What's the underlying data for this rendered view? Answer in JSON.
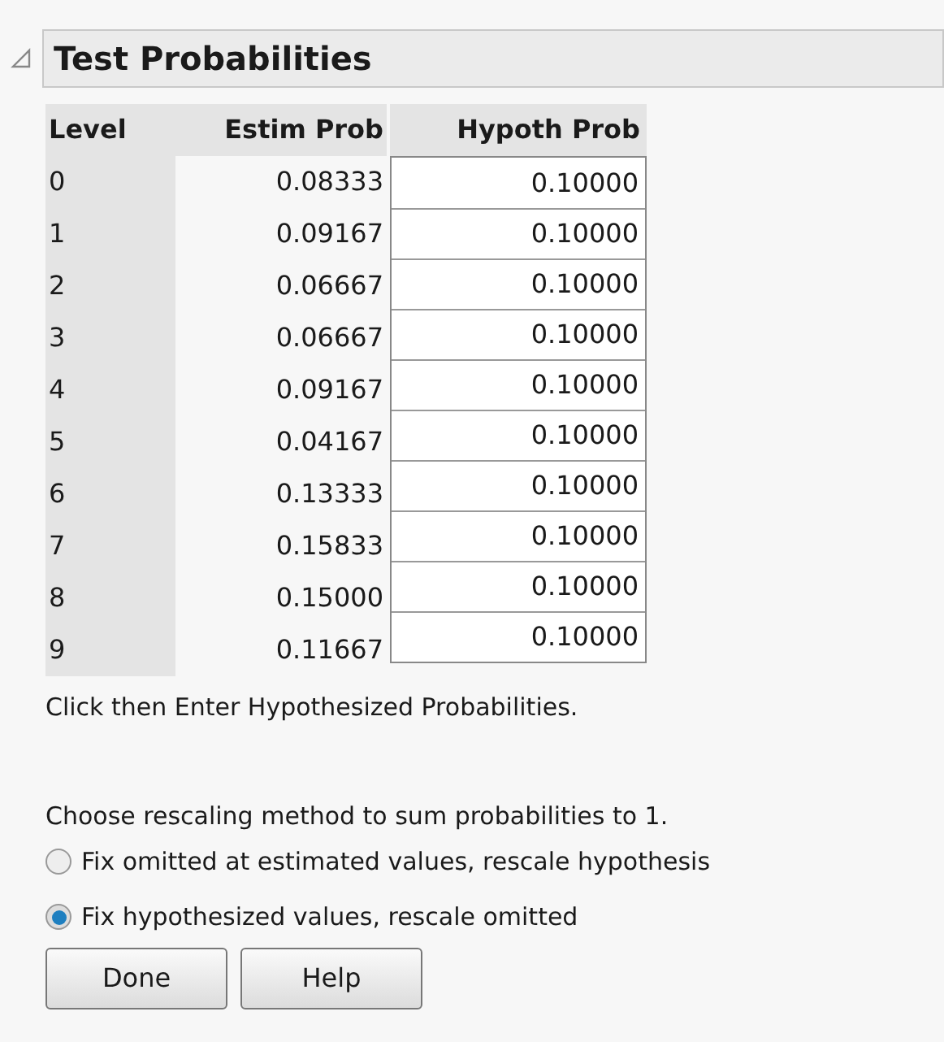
{
  "panel": {
    "title": "Test Probabilities",
    "expanded": true
  },
  "table": {
    "columns": [
      "Level",
      "Estim Prob",
      "Hypoth Prob"
    ],
    "rows": [
      {
        "level": "0",
        "estim": "0.08333",
        "hypoth": "0.10000"
      },
      {
        "level": "1",
        "estim": "0.09167",
        "hypoth": "0.10000"
      },
      {
        "level": "2",
        "estim": "0.06667",
        "hypoth": "0.10000"
      },
      {
        "level": "3",
        "estim": "0.06667",
        "hypoth": "0.10000"
      },
      {
        "level": "4",
        "estim": "0.09167",
        "hypoth": "0.10000"
      },
      {
        "level": "5",
        "estim": "0.04167",
        "hypoth": "0.10000"
      },
      {
        "level": "6",
        "estim": "0.13333",
        "hypoth": "0.10000"
      },
      {
        "level": "7",
        "estim": "0.15833",
        "hypoth": "0.10000"
      },
      {
        "level": "8",
        "estim": "0.15000",
        "hypoth": "0.10000"
      },
      {
        "level": "9",
        "estim": "0.11667",
        "hypoth": "0.10000"
      }
    ]
  },
  "instruction": "Click then Enter Hypothesized Probabilities.",
  "rescale_prompt": "Choose rescaling method to sum probabilities to 1.",
  "options": [
    {
      "label": "Fix omitted at estimated values, rescale hypothesis",
      "selected": false
    },
    {
      "label": "Fix hypothesized values, rescale omitted",
      "selected": true
    }
  ],
  "buttons": [
    "Done",
    "Help"
  ]
}
